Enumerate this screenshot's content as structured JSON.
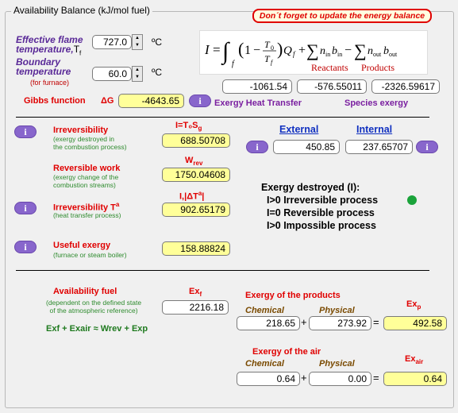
{
  "window": {
    "group_title": "Availability Balance (kJ/mol fuel)"
  },
  "warning": "Don´t forget to update the energy balance",
  "flame_temp": {
    "label_line1": "Effective flame",
    "label_line2": "temperature,",
    "symbol": "T",
    "sub": "f",
    "value": "727.0",
    "unit": "ºC"
  },
  "boundary_temp": {
    "label_line1": "Boundary",
    "label_line2": "temperature",
    "sublabel": "(for furnace)",
    "value": "60.0",
    "unit": "ºC"
  },
  "gibbs": {
    "label": "Gibbs function",
    "symbol": "ΔG",
    "value": "-4643.65"
  },
  "formula_terms": {
    "reactants": "Reactants",
    "products": "Products",
    "term1": "-1061.54",
    "term2": "-576.55011",
    "term3": "-2326.59617"
  },
  "exergy_heat_transfer": "Exergy Heat Transfer",
  "species_exergy": "Species exergy",
  "irreversibility": {
    "label": "Irreversibility",
    "desc_line1": "(exergy destroyed in",
    "desc_line2": "the combustion process)",
    "formula": "I=T₀S",
    "formula_sub": "g",
    "value": "688.50708"
  },
  "external_internal": {
    "external_label": "External",
    "internal_label": "Internal",
    "external_value": "450.85",
    "internal_value": "237.65707"
  },
  "reversible_work": {
    "label": "Reversible work",
    "desc_line1": "(exergy change of the",
    "desc_line2": "combustion streams)",
    "symbol": "W",
    "symbol_sub": "rev",
    "value": "1750.04608"
  },
  "irreversibility_T": {
    "label": "Irreversibility T",
    "label_sup": "a",
    "desc": "(heat transfer process)",
    "formula": "I,|ΔT",
    "formula_sup": "a",
    "formula_end": "|",
    "value": "902.65179"
  },
  "exergy_destroyed": {
    "title": "Exergy destroyed (I):",
    "line1": "I>0 Irreversible process",
    "line2": "I=0 Reversible process",
    "line3": "I>0 Impossible process",
    "status_color": "#1aa33a"
  },
  "useful_exergy": {
    "label": "Useful exergy",
    "desc": "(furnace or steam boiler)",
    "value": "158.88824"
  },
  "availability_fuel": {
    "label": "Availability fuel",
    "desc_line1": "(dependent on the defined state",
    "desc_line2": "of the atmospheric reference)",
    "symbol": "Ex",
    "symbol_sub": "f",
    "value": "2216.18",
    "equation": "Exf + Exair ≈ Wrev + Exp"
  },
  "products": {
    "title": "Exergy of the products",
    "chemical_label": "Chemical",
    "physical_label": "Physical",
    "chemical": "218.65",
    "physical": "273.92",
    "total_symbol": "Ex",
    "total_sub": "p",
    "total": "492.58"
  },
  "air": {
    "title": "Exergy of the air",
    "chemical_label": "Chemical",
    "physical_label": "Physical",
    "chemical": "0.64",
    "physical": "0.00",
    "total_symbol": "Ex",
    "total_sub": "air",
    "total": "0.64"
  },
  "info_button": "i",
  "icons": {
    "spin_up": "spin-up-icon",
    "spin_down": "spin-down-icon",
    "info": "info-icon",
    "status": "status-dot-icon"
  },
  "colors": {
    "warning": "#e00000",
    "purple_button": "#8866cc",
    "yellow_field": "#ffff99",
    "label_red": "#e00000",
    "label_purple": "#5a2a98"
  }
}
